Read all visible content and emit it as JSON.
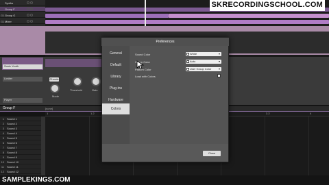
{
  "watermark_top": "SKRECORDINGSCHOOL.COM",
  "watermark_bottom": "SAMPLEKINGS.COM",
  "top_tracks": [
    {
      "num": "",
      "name": "Synths"
    },
    {
      "num": "",
      "name": "Group F"
    },
    {
      "num": "G1",
      "name": "Group G"
    },
    {
      "num": "G1",
      "name": "Mixer"
    }
  ],
  "instrument": {
    "name": "Sonic Youth",
    "sub": "Limiter",
    "sub2": "Player"
  },
  "device": {
    "chord_label": "Chords",
    "knob1_label": "Mode",
    "knob2_label": "Threshold",
    "knob3_label": "Gain"
  },
  "group": {
    "label": "Group F",
    "tag": "[none]"
  },
  "ruler_ticks": [
    "1",
    "1.2",
    "2",
    "2.2",
    "3",
    "3.2",
    "4"
  ],
  "sounds": [
    {
      "num": "1",
      "name": "Sound 1"
    },
    {
      "num": "2",
      "name": "Sound 2"
    },
    {
      "num": "3",
      "name": "Sound 3"
    },
    {
      "num": "4",
      "name": "Sound 4"
    },
    {
      "num": "5",
      "name": "Sound 5"
    },
    {
      "num": "6",
      "name": "Sound 6"
    },
    {
      "num": "7",
      "name": "Sound 7"
    },
    {
      "num": "8",
      "name": "Sound 8"
    },
    {
      "num": "9",
      "name": "Sound 9"
    },
    {
      "num": "10",
      "name": "Sound 10"
    },
    {
      "num": "11",
      "name": "Sound 11"
    },
    {
      "num": "12",
      "name": "Sound 12"
    }
  ],
  "dialog": {
    "title": "Preferences",
    "nav": [
      "General",
      "Default",
      "Library",
      "Plug-ins",
      "Hardware",
      "Colors"
    ],
    "selected_nav": "Colors",
    "options": [
      {
        "label": "Sound Color",
        "value": "White"
      },
      {
        "label": "Group Color",
        "value": "Auto"
      },
      {
        "label": "Pattern Color",
        "value": "User Group Color"
      }
    ],
    "checkbox_label": "Load with Colors",
    "close_label": "Close"
  },
  "colors": {
    "accent_purple": "#b07cc6",
    "clip_purple": "#9c6fb8",
    "clip_pink": "#c58fce",
    "band_pink": "#a98aa7"
  }
}
